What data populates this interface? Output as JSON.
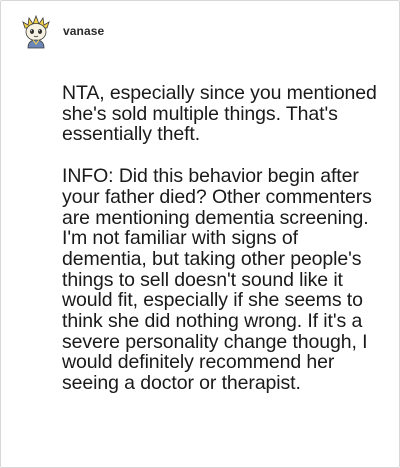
{
  "post": {
    "author": {
      "username": "vanase",
      "avatar_icon": "cartoon-character-avatar-icon"
    },
    "paragraphs": [
      "NTA, especially since you mentioned she's sold multiple things. That's essentially theft.",
      "INFO: Did this behavior begin after your father died? Other commenters are mentioning dementia screening. I'm not familiar with signs of dementia, but taking other people's things to sell doesn't sound like it would fit, especially if she seems to think she did nothing wrong. If it's a severe personality change though, I would definitely recommend her seeing a doctor or therapist."
    ]
  }
}
